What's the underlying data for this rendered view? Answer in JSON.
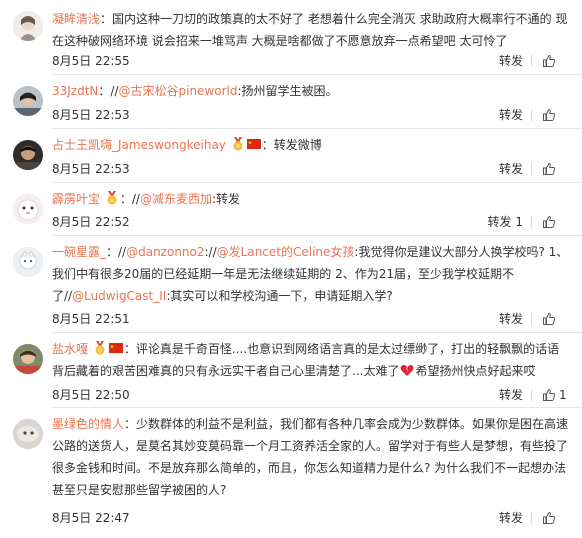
{
  "comments": [
    {
      "user": "凝眸清浅",
      "segments": [
        {
          "t": "text",
          "v": "：国内这种一刀切的政策真的太不好了 老想着什么完全消灭 求助政府大概率行不通的 现在这种破网络环境 说会招来一堆骂声 大概是啥都做了不愿意放弃一点希望吧 太可怜了"
        }
      ],
      "time": "8月5日 22:55",
      "repost": "转发",
      "likes": ""
    },
    {
      "user": "33JzdtN",
      "segments": [
        {
          "t": "text",
          "v": "：//"
        },
        {
          "t": "at",
          "v": "@古宋松谷pineworld"
        },
        {
          "t": "text",
          "v": ":扬州留学生被困。"
        }
      ],
      "time": "8月5日 22:53",
      "repost": "转发",
      "likes": ""
    },
    {
      "user": "占士王凯嗨_Jameswongkeihay",
      "segments": [
        {
          "t": "text",
          "v": "：转发微博"
        }
      ],
      "time": "8月5日 22:53",
      "repost": "转发",
      "likes": ""
    },
    {
      "user": "霹雳叶宝",
      "segments": [
        {
          "t": "text",
          "v": "：//"
        },
        {
          "t": "at",
          "v": "@减东麦西加"
        },
        {
          "t": "text",
          "v": ":转发"
        }
      ],
      "time": "8月5日 22:52",
      "repost": "转发 1",
      "likes": ""
    },
    {
      "user": "一碗星露_",
      "segments": [
        {
          "t": "text",
          "v": "：//"
        },
        {
          "t": "at",
          "v": "@danzonno2"
        },
        {
          "t": "text",
          "v": "://"
        },
        {
          "t": "at",
          "v": "@发Lancet的Celine女孩"
        },
        {
          "t": "text",
          "v": ":我觉得你是建议大部分人换学校吗? 1、我们中有很多20届的已经延期一年是无法继续延期的 2、作为21届，至少我学校延期不了//"
        },
        {
          "t": "at",
          "v": "@LudwigCast_II"
        },
        {
          "t": "text",
          "v": ":其实可以和学校沟通一下，申请延期入学?"
        }
      ],
      "time": "8月5日 22:51",
      "repost": "转发",
      "likes": ""
    },
    {
      "user": "盐水嘎",
      "segments": [
        {
          "t": "text",
          "v": "：评论真是千奇百怪....也意识到网络语言真的是太过缥缈了，打出的轻飘飘的话语背后藏着的艰苦困难真的只有永远实干者自己心里清楚了...太难了"
        },
        {
          "t": "emoji",
          "v": "broken-heart"
        },
        {
          "t": "text",
          "v": "希望扬州快点好起来哎"
        }
      ],
      "time": "8月5日 22:50",
      "repost": "转发",
      "likes": "1"
    },
    {
      "user": "墨绿色的情人",
      "segments": [
        {
          "t": "text",
          "v": "：少数群体的利益不是利益，我们都有各种几率会成为少数群体。如果你是困在高速公路的送货人，是莫名其妙变莫码靠一个月工资养活全家的人。留学对于有些人是梦想，有些投了很多金钱和时间。不是放弃那么简单的，而且，你怎么知道精力是什么? 为什么我们不一起想办法甚至只是安慰那些留学被困的人?"
        }
      ],
      "time": "8月5日 22:47",
      "repost": "转发",
      "likes": ""
    }
  ],
  "colors": {
    "username": "#eb7350",
    "text": "#333333",
    "separator": "#e6e6e6"
  },
  "icons": {
    "like": "thumbs-up-icon",
    "verified": "v-badge-icon",
    "flag": "china-flag-icon",
    "medal": "medal-icon",
    "broken_heart": "broken-heart-icon"
  }
}
